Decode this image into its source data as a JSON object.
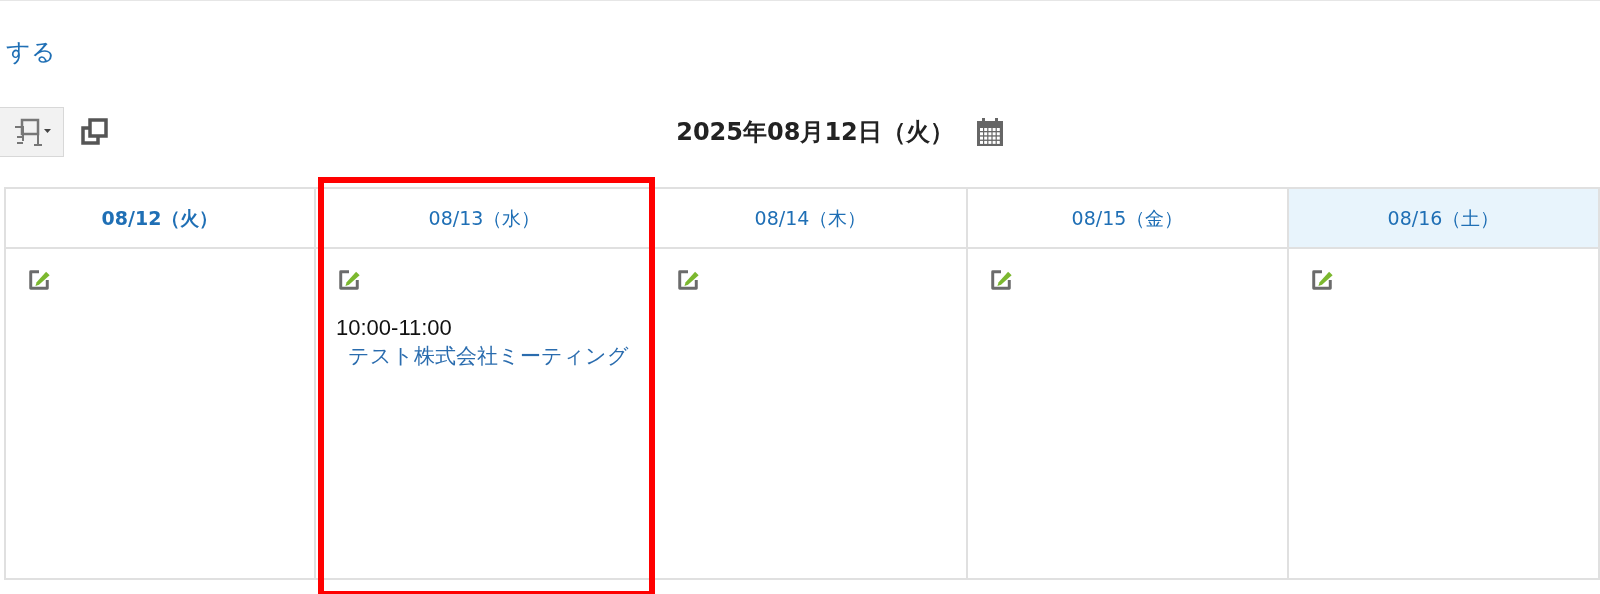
{
  "top_link": "する",
  "date_title": "2025年08月12日（火）",
  "days": [
    {
      "label": "08/12（火）",
      "today": true,
      "kind": "weekday",
      "highlighted": false
    },
    {
      "label": "08/13（水）",
      "today": false,
      "kind": "weekday",
      "highlighted": true,
      "events": [
        {
          "time": "10:00-11:00",
          "title": "テスト株式会社ミーティング"
        }
      ]
    },
    {
      "label": "08/14（木）",
      "today": false,
      "kind": "weekday",
      "highlighted": false
    },
    {
      "label": "08/15（金）",
      "today": false,
      "kind": "weekday",
      "highlighted": false
    },
    {
      "label": "08/16（土）",
      "today": false,
      "kind": "saturday",
      "highlighted": false
    }
  ]
}
